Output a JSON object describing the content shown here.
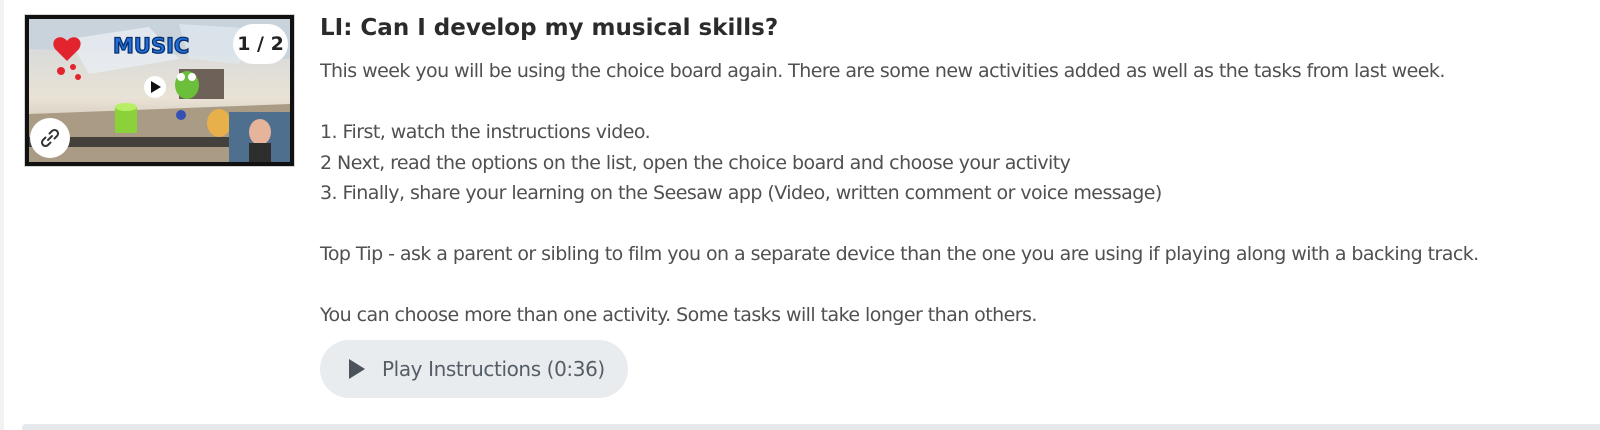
{
  "post": {
    "thumbnail": {
      "counter": "1 / 2",
      "thumbnail_word": "MUSIC",
      "link_icon": "link-icon"
    },
    "title": "LI: Can I develop my musical skills?",
    "lines": [
      "This week you will be using the choice board again. There are some new activities added as well as the tasks from last week.",
      "",
      "1. First, watch the instructions video.",
      "2  Next, read the options on the list, open the choice board and choose your activity",
      "3.  Finally, share your learning on the Seesaw app (Video, written comment or voice message)",
      "",
      "Top Tip -  ask a parent or sibling to film you on a separate device than the one you are using if playing along with a backing track.",
      "",
      "You can choose more than one activity. Some tasks will take longer than others."
    ],
    "play_button": {
      "label": "Play Instructions (0:36)",
      "icon": "play-icon"
    }
  }
}
